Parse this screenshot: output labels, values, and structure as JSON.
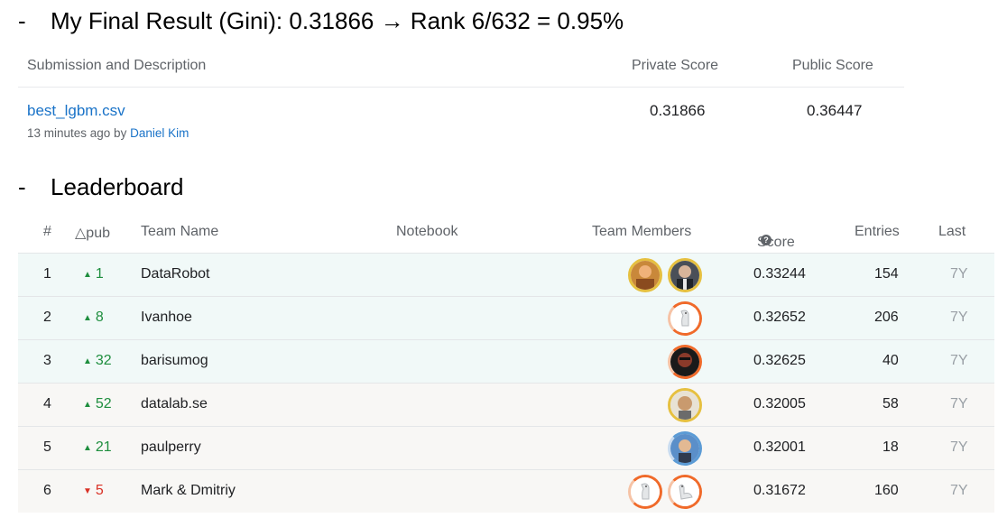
{
  "headings": {
    "result": "My Final Result (Gini): 0.31866 → Rank 6/632 = 0.95%",
    "leaderboard": "Leaderboard",
    "dash": "-"
  },
  "submission": {
    "columns": [
      "Submission and Description",
      "Private Score",
      "Public Score"
    ],
    "file": "best_lgbm.csv",
    "meta_prefix": "13 minutes ago by",
    "user": "Daniel Kim",
    "private_score": "0.31866",
    "public_score": "0.36447"
  },
  "leaderboard": {
    "columns": {
      "rank": "#",
      "delta": "△pub",
      "team": "Team Name",
      "notebook": "Notebook",
      "members": "Team Members",
      "score": "Score",
      "entries": "Entries",
      "last": "Last"
    },
    "rows": [
      {
        "rank": "1",
        "delta": "1",
        "dir": "up",
        "team": "DataRobot",
        "score": "0.33244",
        "entries": "154",
        "last": "7Y"
      },
      {
        "rank": "2",
        "delta": "8",
        "dir": "up",
        "team": "Ivanhoe",
        "score": "0.32652",
        "entries": "206",
        "last": "7Y"
      },
      {
        "rank": "3",
        "delta": "32",
        "dir": "up",
        "team": "barisumog",
        "score": "0.32625",
        "entries": "40",
        "last": "7Y"
      },
      {
        "rank": "4",
        "delta": "52",
        "dir": "up",
        "team": "datalab.se",
        "score": "0.32005",
        "entries": "58",
        "last": "7Y"
      },
      {
        "rank": "5",
        "delta": "21",
        "dir": "up",
        "team": "paulperry",
        "score": "0.32001",
        "entries": "18",
        "last": "7Y"
      },
      {
        "rank": "6",
        "delta": "5",
        "dir": "down",
        "team": "Mark & Dmitriy",
        "score": "0.31672",
        "entries": "160",
        "last": "7Y"
      }
    ]
  },
  "colors": {
    "link": "#1a73c8",
    "up": "#1e8e3e",
    "down": "#d93025",
    "gold_row": "#f1f9f8",
    "row": "#f8f7f5"
  }
}
